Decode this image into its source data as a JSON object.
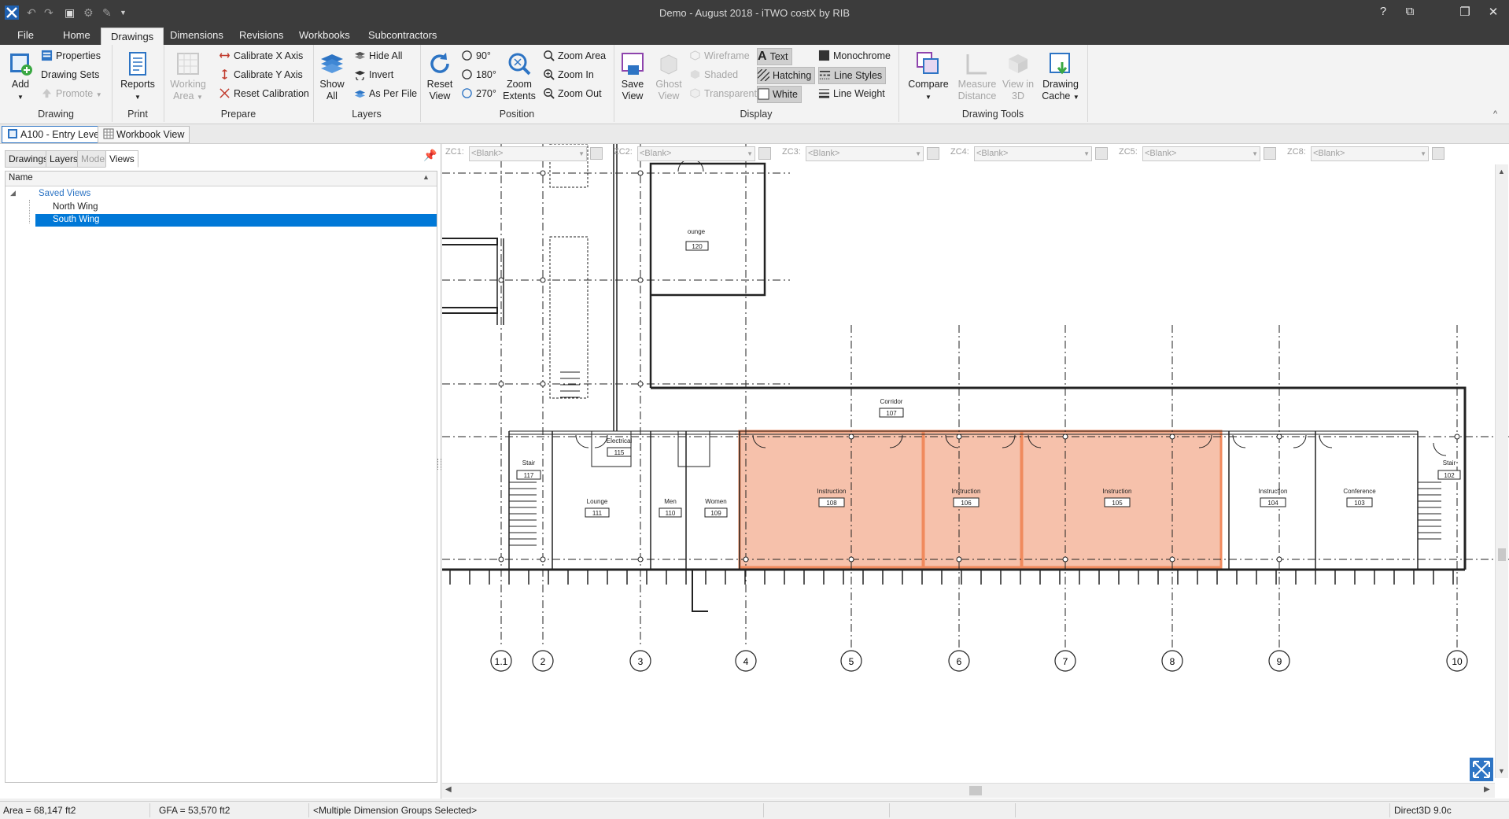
{
  "window": {
    "title": "Demo - August 2018 - iTWO costX by RIB",
    "controls": {
      "help": "?",
      "restore_panel": "⧉",
      "restore": "❐",
      "close": "✕"
    }
  },
  "tabs": [
    "File",
    "Home",
    "Drawings",
    "Dimensions",
    "Revisions",
    "Workbooks",
    "Subcontractors"
  ],
  "ribbon": {
    "drawing": {
      "label": "Drawing",
      "add": "Add",
      "properties": "Properties",
      "drawing_sets": "Drawing Sets",
      "promote": "Promote"
    },
    "print": {
      "label": "Print",
      "reports": "Reports"
    },
    "prepare": {
      "label": "Prepare",
      "working_area": "Working Area",
      "calibrate_x": "Calibrate X Axis",
      "calibrate_y": "Calibrate Y Axis",
      "reset_calibration": "Reset Calibration"
    },
    "layers": {
      "label": "Layers",
      "show_all": "Show All",
      "hide_all": "Hide All",
      "invert": "Invert",
      "as_per_file": "As Per File"
    },
    "position": {
      "label": "Position",
      "reset_view": "Reset View",
      "r90": "90°",
      "r180": "180°",
      "r270": "270°",
      "zoom_extents": "Zoom Extents",
      "zoom_area": "Zoom Area",
      "zoom_in": "Zoom In",
      "zoom_out": "Zoom Out"
    },
    "display": {
      "label": "Display",
      "save_view": "Save View",
      "ghost_view": "Ghost View",
      "wireframe": "Wireframe",
      "shaded": "Shaded",
      "transparent": "Transparent",
      "text": "Text",
      "hatching": "Hatching",
      "white": "White",
      "monochrome": "Monochrome",
      "line_styles": "Line Styles",
      "line_weight": "Line Weight"
    },
    "tools": {
      "label": "Drawing Tools",
      "compare": "Compare",
      "measure_distance": "Measure Distance",
      "view_3d": "View in 3D",
      "drawing_cache": "Drawing Cache"
    }
  },
  "doc_tabs": {
    "drawing": "A100 - Entry Level",
    "workbook": "Workbook View"
  },
  "left_panel": {
    "tabs": [
      "Drawings",
      "Layers",
      "Model",
      "Views"
    ],
    "column_header": "Name",
    "tree": {
      "root": "Saved Views",
      "items": [
        "North Wing",
        "South Wing"
      ],
      "selected": "South Wing"
    }
  },
  "zc_filters": [
    {
      "label": "ZC1:",
      "value": "<Blank>"
    },
    {
      "label": "ZC2:",
      "value": "<Blank>"
    },
    {
      "label": "ZC3:",
      "value": "<Blank>"
    },
    {
      "label": "ZC4:",
      "value": "<Blank>"
    },
    {
      "label": "ZC5:",
      "value": "<Blank>"
    },
    {
      "label": "ZC8:",
      "value": "<Blank>"
    }
  ],
  "drawing": {
    "grid_labels": [
      "1.1",
      "2",
      "3",
      "4",
      "5",
      "6",
      "7",
      "8",
      "9",
      "10"
    ],
    "rooms": {
      "corridor": {
        "name": "Corridor",
        "num": "107"
      },
      "lounge_top": {
        "name": "ounge",
        "num": "120"
      },
      "stair_left": {
        "name": "Stair",
        "num": "117"
      },
      "electrical": {
        "name": "Electrical",
        "num": "115"
      },
      "lounge": {
        "name": "Lounge",
        "num": "111"
      },
      "men": {
        "name": "Men",
        "num": "110"
      },
      "women": {
        "name": "Women",
        "num": "109"
      },
      "instruction1": {
        "name": "Instruction",
        "num": "108"
      },
      "instruction2": {
        "name": "Instruction",
        "num": "106"
      },
      "instruction3": {
        "name": "Instruction",
        "num": "105"
      },
      "instruction4": {
        "name": "Instruction",
        "num": "104"
      },
      "conference": {
        "name": "Conference",
        "num": "103"
      },
      "stair_right": {
        "name": "Stair",
        "num": "102"
      }
    },
    "highlight_color": "#f6b8a0",
    "highlight_border": "#f08a5d"
  },
  "status": {
    "area": "Area = 68,147 ft2",
    "gfa": "GFA = 53,570 ft2",
    "selection": "<Multiple Dimension Groups Selected>",
    "renderer": "Direct3D 9.0c"
  }
}
